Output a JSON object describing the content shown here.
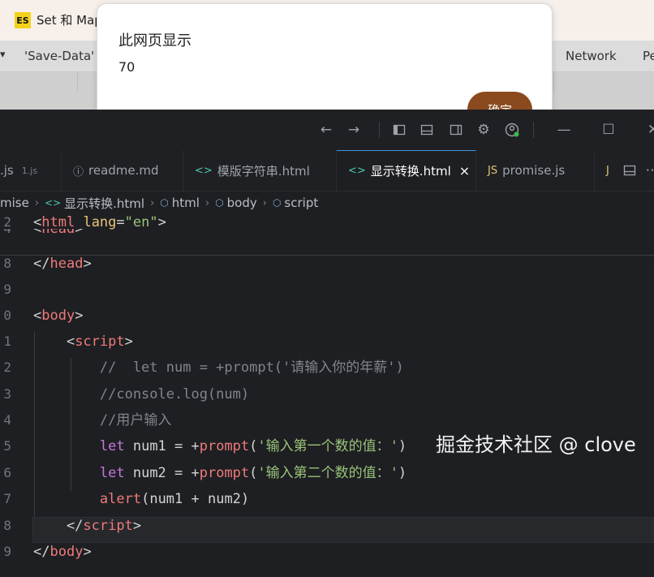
{
  "browser": {
    "tab_icon": "ES",
    "tab_title": "Set 和 Map",
    "devtools_arrow": "▾",
    "devtools_data_tab": "'Save-Data'",
    "devtools_network": "Network",
    "devtools_perf": "Pe"
  },
  "alert": {
    "title": "此网页显示",
    "message": "70",
    "ok_label": "确定"
  },
  "titlebar": {
    "icons": [
      "back-arrow-icon",
      "forward-arrow-icon",
      "toggle-primary-sidebar-icon",
      "toggle-panel-icon",
      "toggle-secondary-sidebar-icon",
      "settings-gear-icon",
      "account-icon",
      "minimize-icon",
      "maximize-icon",
      "close-icon"
    ]
  },
  "tabs": [
    {
      "name": "tab-js-file",
      "icon": "",
      "label": ".js",
      "sub": "1.js"
    },
    {
      "name": "tab-readme",
      "icon": "ⓘ",
      "label": "readme.md"
    },
    {
      "name": "tab-template-string",
      "icon": "<>",
      "label": "模版字符串.html"
    },
    {
      "name": "tab-display-convert",
      "icon": "<>",
      "label": "显示转换.html",
      "close": "×",
      "active": true
    },
    {
      "name": "tab-promise",
      "icon": "JS",
      "label": "promise.js"
    },
    {
      "name": "tab-overflow",
      "icon": "J",
      "label": ""
    }
  ],
  "breadcrumb": {
    "items": [
      "mise",
      "显示转换.html",
      "html",
      "body",
      "script"
    ]
  },
  "editor": {
    "lines": [
      {
        "n": "2",
        "tokens": [
          [
            "punct",
            "<"
          ],
          [
            "tag",
            "html"
          ],
          [
            "punct",
            " "
          ],
          [
            "attr",
            "lang"
          ],
          [
            "punct",
            "="
          ],
          [
            "str",
            "\"en\""
          ],
          [
            "punct",
            ">"
          ]
        ]
      },
      {
        "n": "8",
        "tokens": [
          [
            "punct",
            "</"
          ],
          [
            "tag",
            "head"
          ],
          [
            "punct",
            ">"
          ]
        ]
      },
      {
        "n": "9",
        "tokens": []
      },
      {
        "n": "0",
        "tokens": [
          [
            "punct",
            "<"
          ],
          [
            "tag",
            "body"
          ],
          [
            "punct",
            ">"
          ]
        ]
      },
      {
        "n": "1",
        "tokens": [
          [
            "punct",
            "    <"
          ],
          [
            "tag",
            "script"
          ],
          [
            "punct",
            ">"
          ]
        ]
      },
      {
        "n": "2",
        "tokens": [
          [
            "cmt",
            "        //  let num = +prompt('请输入你的年薪')"
          ]
        ]
      },
      {
        "n": "3",
        "tokens": [
          [
            "cmt",
            "        //console.log(num)"
          ]
        ]
      },
      {
        "n": "4",
        "tokens": [
          [
            "cmt",
            "        //用户输入"
          ]
        ]
      },
      {
        "n": "5",
        "tokens": [
          [
            "punct",
            "        "
          ],
          [
            "kw",
            "let"
          ],
          [
            "var",
            " num1 = +"
          ],
          [
            "fn",
            "prompt"
          ],
          [
            "punct",
            "("
          ],
          [
            "str",
            "'输入第一个数的值：'"
          ],
          [
            "punct",
            ")"
          ]
        ]
      },
      {
        "n": "6",
        "tokens": [
          [
            "punct",
            "        "
          ],
          [
            "kw",
            "let"
          ],
          [
            "var",
            " num2 = +"
          ],
          [
            "fn",
            "prompt"
          ],
          [
            "punct",
            "("
          ],
          [
            "str",
            "'输入第二个数的值：'"
          ],
          [
            "punct",
            ")"
          ]
        ]
      },
      {
        "n": "7",
        "tokens": [
          [
            "punct",
            "        "
          ],
          [
            "fn",
            "alert"
          ],
          [
            "punct",
            "("
          ],
          [
            "var",
            "num1 + num2"
          ],
          [
            "punct",
            ")"
          ]
        ]
      },
      {
        "n": "8",
        "tokens": [
          [
            "punct",
            "    </"
          ],
          [
            "tag",
            "script"
          ],
          [
            "punct",
            ">"
          ]
        ]
      },
      {
        "n": "9",
        "tokens": [
          [
            "punct",
            "</"
          ],
          [
            "tag",
            "body"
          ],
          [
            "punct",
            ">"
          ]
        ]
      }
    ],
    "peek_line": "<head>",
    "peek_ln": "4"
  },
  "watermark": "掘金技术社区 @ clove"
}
